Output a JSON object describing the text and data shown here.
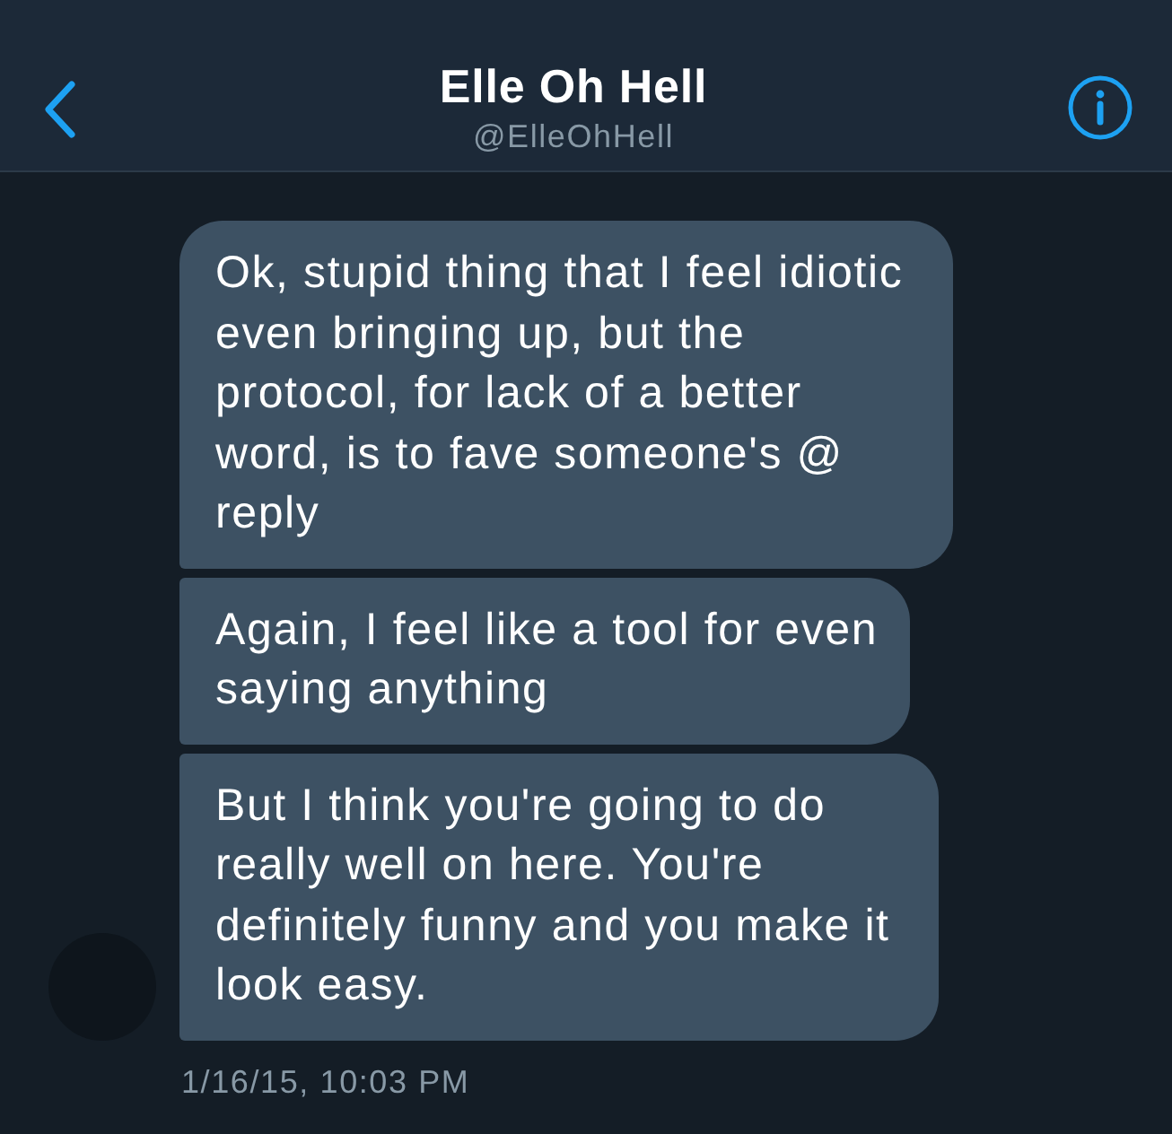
{
  "header": {
    "title": "Elle Oh Hell",
    "handle": "@ElleOhHell"
  },
  "messages": [
    {
      "text": "Ok, stupid thing that I feel idiotic even bringing up, but the protocol, for lack of a better word, is to fave someone's @ reply"
    },
    {
      "text": "Again, I feel like a tool for even saying anything"
    },
    {
      "text": "But I think you're going to do really well on here. You're definitely funny and you make it look easy."
    }
  ],
  "timestamp": "1/16/15, 10:03 PM"
}
